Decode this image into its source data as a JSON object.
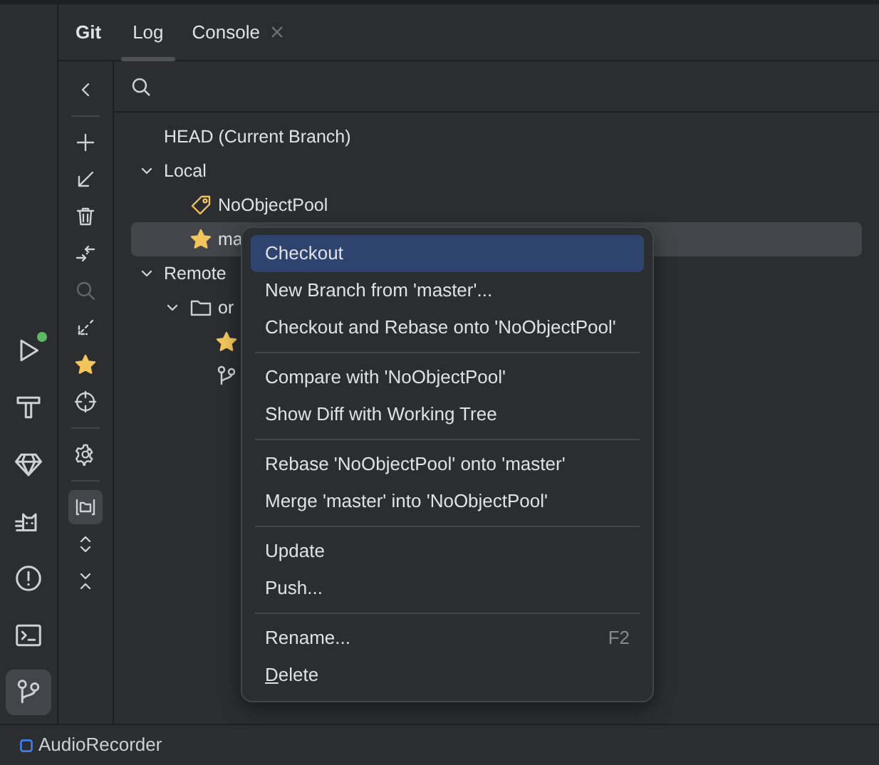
{
  "tool_window": {
    "title": "Git",
    "tabs": [
      {
        "label": "Log",
        "selected": true,
        "closable": false
      },
      {
        "label": "Console",
        "selected": false,
        "closable": true
      }
    ]
  },
  "left_strip": [
    {
      "kind": "run",
      "selected": false,
      "badge": true
    },
    {
      "kind": "build",
      "selected": false,
      "badge": false
    },
    {
      "kind": "gem",
      "selected": false,
      "badge": false
    },
    {
      "kind": "cat",
      "selected": false,
      "badge": false
    },
    {
      "kind": "problems",
      "selected": false,
      "badge": false
    },
    {
      "kind": "terminal",
      "selected": false,
      "badge": false
    },
    {
      "kind": "git",
      "selected": true,
      "badge": false
    }
  ],
  "toolbar": [
    {
      "kind": "back",
      "disabled": false,
      "selected": false
    },
    {
      "kind": "sep"
    },
    {
      "kind": "add",
      "disabled": false,
      "selected": false
    },
    {
      "kind": "checkout",
      "disabled": false,
      "selected": false
    },
    {
      "kind": "delete",
      "disabled": false,
      "selected": false
    },
    {
      "kind": "compare",
      "disabled": false,
      "selected": false
    },
    {
      "kind": "search",
      "disabled": true,
      "selected": false
    },
    {
      "kind": "update",
      "disabled": false,
      "selected": false
    },
    {
      "kind": "favorite",
      "disabled": false,
      "selected": false
    },
    {
      "kind": "target",
      "disabled": false,
      "selected": false
    },
    {
      "kind": "sep"
    },
    {
      "kind": "settings",
      "disabled": false,
      "selected": false
    },
    {
      "kind": "sep"
    },
    {
      "kind": "group",
      "disabled": false,
      "selected": true
    },
    {
      "kind": "expand",
      "disabled": false,
      "selected": false
    },
    {
      "kind": "collapse",
      "disabled": false,
      "selected": false
    }
  ],
  "tree": [
    {
      "label": "HEAD (Current Branch)",
      "kind": "plain",
      "selected": false
    },
    {
      "label": "Local",
      "kind": "group",
      "expanded": true,
      "selected": false,
      "children": [
        {
          "label": "NoObjectPool",
          "kind": "tag",
          "selected": false
        },
        {
          "label": "ma",
          "kind": "favorite",
          "selected": true
        }
      ]
    },
    {
      "label": "Remote",
      "kind": "group",
      "expanded": true,
      "selected": false,
      "children": [
        {
          "label": "or",
          "kind": "folder",
          "expanded": true,
          "selected": false,
          "children": [
            {
              "kind": "favorite",
              "selected": false
            },
            {
              "kind": "branch",
              "selected": false
            }
          ]
        }
      ]
    }
  ],
  "context_menu": [
    [
      {
        "label": "Checkout",
        "selected": true
      },
      {
        "label": "New Branch from 'master'...",
        "selected": false
      },
      {
        "label": "Checkout and Rebase onto 'NoObjectPool'",
        "selected": false
      }
    ],
    [
      {
        "label": "Compare with 'NoObjectPool'",
        "selected": false
      },
      {
        "label": "Show Diff with Working Tree",
        "selected": false
      }
    ],
    [
      {
        "label": "Rebase 'NoObjectPool' onto 'master'",
        "selected": false
      },
      {
        "label": "Merge 'master' into 'NoObjectPool'",
        "selected": false
      }
    ],
    [
      {
        "label": "Update",
        "selected": false
      },
      {
        "label": "Push...",
        "selected": false
      }
    ],
    [
      {
        "label": "Rename...",
        "selected": false,
        "shortcut": "F2"
      },
      {
        "label": "Delete",
        "selected": false,
        "mnemonic": true
      }
    ]
  ],
  "status_bar": {
    "project": "AudioRecorder"
  }
}
